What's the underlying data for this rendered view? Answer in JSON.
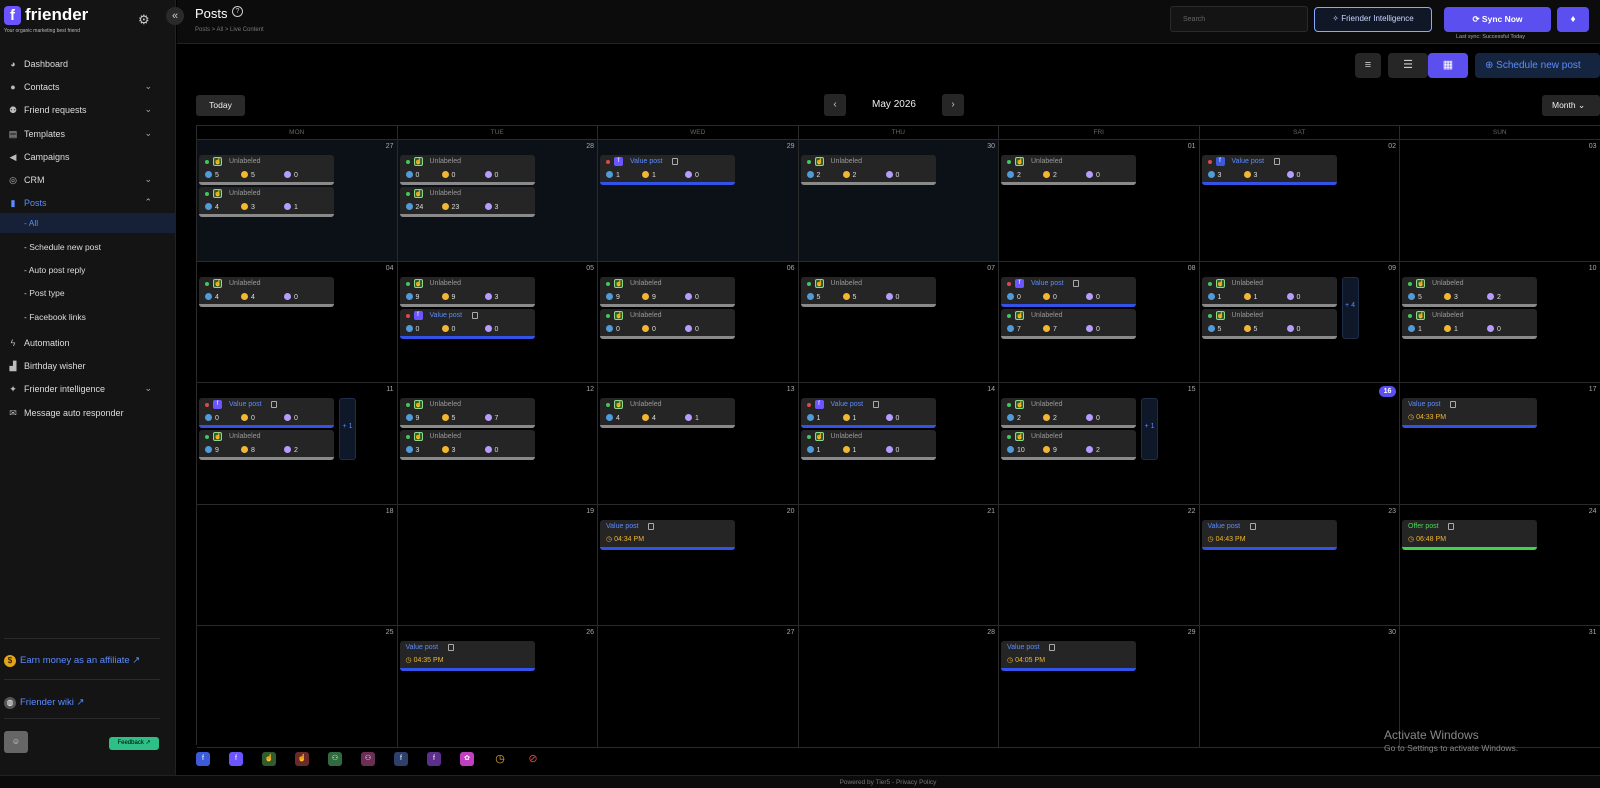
{
  "brand": {
    "name": "friender",
    "tagline": "Your organic marketing best friend",
    "logo_letter": "f"
  },
  "sidebar": {
    "items": [
      {
        "label": "Dashboard",
        "icon": "dashboard-icon",
        "glyph": "◕",
        "expand": false
      },
      {
        "label": "Contacts",
        "icon": "contacts-icon",
        "glyph": "●",
        "expand": true
      },
      {
        "label": "Friend requests",
        "icon": "friend-requests-icon",
        "glyph": "⚉",
        "expand": true
      },
      {
        "label": "Templates",
        "icon": "templates-icon",
        "glyph": "▤",
        "expand": true
      },
      {
        "label": "Campaigns",
        "icon": "campaigns-icon",
        "glyph": "◀",
        "expand": false
      },
      {
        "label": "CRM",
        "icon": "crm-icon",
        "glyph": "◎",
        "expand": true
      },
      {
        "label": "Posts",
        "icon": "posts-icon",
        "glyph": "▮",
        "expand": true,
        "active": true
      }
    ],
    "sub_items": [
      {
        "label": "- All",
        "active": true
      },
      {
        "label": "- Schedule new post"
      },
      {
        "label": "- Auto post reply"
      },
      {
        "label": "- Post type"
      },
      {
        "label": "- Facebook links"
      }
    ],
    "items2": [
      {
        "label": "Automation",
        "icon": "automation-icon",
        "glyph": "ϟ",
        "expand": false
      },
      {
        "label": "Birthday wisher",
        "icon": "birthday-icon",
        "glyph": "▟",
        "expand": false
      },
      {
        "label": "Friender intelligence",
        "icon": "intelligence-icon",
        "glyph": "✦",
        "expand": true
      },
      {
        "label": "Message auto responder",
        "icon": "auto-responder-icon",
        "glyph": "✉",
        "expand": false
      }
    ],
    "affiliate": "Earn money as an affiliate",
    "wiki": "Friender wiki",
    "feedback": "Feedback"
  },
  "header": {
    "title": "Posts",
    "breadcrumb": "Posts  >  All  >  Live Content",
    "search_placeholder": "Search",
    "intelligence_btn": "Friender Intelligence",
    "sync_btn": "Sync Now",
    "last_sync": "Last sync: Successful Today",
    "schedule_btn": "Schedule new post"
  },
  "calendar": {
    "today_btn": "Today",
    "month_label": "May 2026",
    "view_select": "Month",
    "days_of_week": [
      "MON",
      "TUE",
      "WED",
      "THU",
      "FRI",
      "SAT",
      "SUN"
    ],
    "weeks": [
      [
        {
          "d": "27",
          "other": true,
          "posts": [
            {
              "k": "u",
              "s": [
                "5",
                "5",
                "0"
              ]
            },
            {
              "k": "u",
              "s": [
                "4",
                "3",
                "1"
              ]
            }
          ]
        },
        {
          "d": "28",
          "other": true,
          "posts": [
            {
              "k": "u",
              "s": [
                "0",
                "0",
                "0"
              ]
            },
            {
              "k": "u",
              "s": [
                "24",
                "23",
                "3"
              ]
            }
          ]
        },
        {
          "d": "29",
          "other": true,
          "posts": [
            {
              "k": "v",
              "p": "pp",
              "s": [
                "1",
                "1",
                "0"
              ]
            }
          ]
        },
        {
          "d": "30",
          "other": true,
          "posts": [
            {
              "k": "u",
              "s": [
                "2",
                "2",
                "0"
              ]
            }
          ]
        },
        {
          "d": "01",
          "posts": [
            {
              "k": "u",
              "s": [
                "2",
                "2",
                "0"
              ]
            }
          ]
        },
        {
          "d": "02",
          "posts": [
            {
              "k": "v",
              "p": "fb",
              "s": [
                "3",
                "3",
                "0"
              ]
            }
          ]
        },
        {
          "d": "03",
          "posts": []
        }
      ],
      [
        {
          "d": "04",
          "posts": [
            {
              "k": "u",
              "s": [
                "4",
                "4",
                "0"
              ]
            }
          ]
        },
        {
          "d": "05",
          "posts": [
            {
              "k": "u",
              "s": [
                "9",
                "9",
                "3"
              ]
            },
            {
              "k": "v",
              "p": "pp",
              "s": [
                "0",
                "0",
                "0"
              ]
            }
          ]
        },
        {
          "d": "06",
          "posts": [
            {
              "k": "u",
              "s": [
                "9",
                "9",
                "0"
              ]
            },
            {
              "k": "u",
              "s": [
                "0",
                "0",
                "0"
              ]
            }
          ]
        },
        {
          "d": "07",
          "posts": [
            {
              "k": "u",
              "s": [
                "5",
                "5",
                "0"
              ]
            }
          ]
        },
        {
          "d": "08",
          "posts": [
            {
              "k": "v",
              "p": "pp",
              "s": [
                "0",
                "0",
                "0"
              ]
            },
            {
              "k": "u",
              "s": [
                "7",
                "7",
                "0"
              ]
            }
          ]
        },
        {
          "d": "09",
          "more": "+ 4",
          "posts": [
            {
              "k": "u",
              "s": [
                "1",
                "1",
                "0"
              ]
            },
            {
              "k": "u",
              "s": [
                "5",
                "5",
                "0"
              ]
            }
          ]
        },
        {
          "d": "10",
          "posts": [
            {
              "k": "u",
              "s": [
                "5",
                "3",
                "2"
              ]
            },
            {
              "k": "u",
              "s": [
                "1",
                "1",
                "0"
              ]
            }
          ]
        }
      ],
      [
        {
          "d": "11",
          "more": "+ 1",
          "posts": [
            {
              "k": "v",
              "p": "pp",
              "s": [
                "0",
                "0",
                "0"
              ]
            },
            {
              "k": "u",
              "s": [
                "9",
                "8",
                "2"
              ]
            }
          ]
        },
        {
          "d": "12",
          "posts": [
            {
              "k": "u",
              "s": [
                "9",
                "5",
                "7"
              ]
            },
            {
              "k": "u",
              "s": [
                "3",
                "3",
                "0"
              ]
            }
          ]
        },
        {
          "d": "13",
          "posts": [
            {
              "k": "u",
              "s": [
                "4",
                "4",
                "1"
              ]
            }
          ]
        },
        {
          "d": "14",
          "posts": [
            {
              "k": "v",
              "p": "pp",
              "s": [
                "1",
                "1",
                "0"
              ]
            },
            {
              "k": "u",
              "s": [
                "1",
                "1",
                "0"
              ]
            }
          ]
        },
        {
          "d": "15",
          "more": "+ 1",
          "posts": [
            {
              "k": "u",
              "s": [
                "2",
                "2",
                "0"
              ]
            },
            {
              "k": "u",
              "s": [
                "10",
                "9",
                "2"
              ]
            }
          ]
        },
        {
          "d": "16",
          "today": true,
          "posts": []
        },
        {
          "d": "17",
          "posts": [
            {
              "k": "vs",
              "t": "04:33 PM"
            }
          ]
        }
      ],
      [
        {
          "d": "18",
          "posts": []
        },
        {
          "d": "19",
          "posts": []
        },
        {
          "d": "20",
          "posts": [
            {
              "k": "vs",
              "t": "04:34 PM"
            }
          ]
        },
        {
          "d": "21",
          "posts": []
        },
        {
          "d": "22",
          "posts": []
        },
        {
          "d": "23",
          "posts": [
            {
              "k": "vs",
              "t": "04:43 PM"
            }
          ]
        },
        {
          "d": "24",
          "posts": [
            {
              "k": "os",
              "t": "06:48 PM"
            }
          ]
        }
      ],
      [
        {
          "d": "25",
          "posts": []
        },
        {
          "d": "26",
          "posts": [
            {
              "k": "vs",
              "t": "04:35 PM"
            }
          ]
        },
        {
          "d": "27",
          "posts": []
        },
        {
          "d": "28",
          "posts": []
        },
        {
          "d": "29",
          "posts": [
            {
              "k": "vs",
              "t": "04:05 PM"
            }
          ]
        },
        {
          "d": "30",
          "posts": []
        },
        {
          "d": "31",
          "posts": []
        }
      ]
    ],
    "labels": {
      "unlabeled": "Unlabeled",
      "value": "Value post",
      "offer": "Offer post"
    }
  },
  "bottom_toolbar": [
    {
      "icon": "facebook-blue-icon",
      "bg": "#3b5bdb",
      "g": "f"
    },
    {
      "icon": "facebook-purple-icon",
      "bg": "#6b55ff",
      "g": "f"
    },
    {
      "icon": "hand-green-icon",
      "bg": "#2f5b2f",
      "g": "☝"
    },
    {
      "icon": "hand-red-icon",
      "bg": "#6b2a2a",
      "g": "☝"
    },
    {
      "icon": "group-green-icon",
      "bg": "#2f6b3f",
      "g": "⚇"
    },
    {
      "icon": "group-pink-icon",
      "bg": "#6b2f55",
      "g": "⚇"
    },
    {
      "icon": "friends-blue-icon",
      "bg": "#2f3f6b",
      "g": "f"
    },
    {
      "icon": "friends-purple-icon",
      "bg": "#5b2f8b",
      "g": "f"
    },
    {
      "icon": "flower-icon",
      "bg": "#c040c0",
      "g": "✿"
    },
    {
      "icon": "clock-icon",
      "bg": "transparent",
      "g": "◷"
    },
    {
      "icon": "block-icon",
      "bg": "transparent",
      "g": "⊘"
    }
  ],
  "windows": {
    "activate": "Activate Windows",
    "goto": "Go to Settings to activate Windows."
  },
  "footer": "Powered by Tier5 - Privacy Policy"
}
